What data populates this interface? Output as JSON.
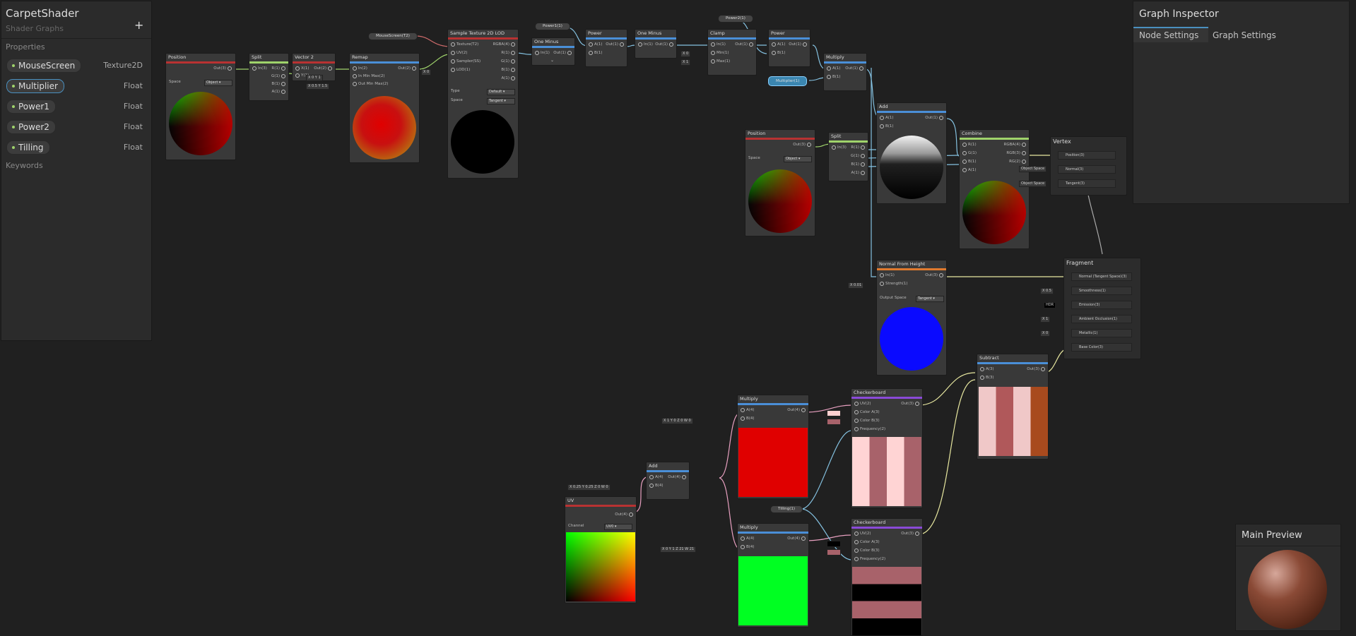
{
  "blackboard": {
    "title": "CarpetShader",
    "subtitle": "Shader Graphs",
    "add_label": "+",
    "properties_header": "Properties",
    "keywords_header": "Keywords",
    "properties": [
      {
        "name": "MouseScreen",
        "type": "Texture2D"
      },
      {
        "name": "Multiplier",
        "type": "Float"
      },
      {
        "name": "Power1",
        "type": "Float"
      },
      {
        "name": "Power2",
        "type": "Float"
      },
      {
        "name": "Tilling",
        "type": "Float"
      }
    ]
  },
  "inspector": {
    "title": "Graph Inspector",
    "tabs": [
      "Node Settings",
      "Graph Settings"
    ]
  },
  "main_preview": {
    "title": "Main Preview"
  },
  "nodes": {
    "position1": {
      "title": "Position",
      "out": "Out(3)",
      "space_label": "Space",
      "space": "Object"
    },
    "split1": {
      "title": "Split",
      "in": "In(3)",
      "outs": [
        "R(1)",
        "G(1)",
        "B(1)",
        "A(1)"
      ]
    },
    "vector2": {
      "title": "Vector 2",
      "in": [
        "X(1)",
        "Y(1)"
      ],
      "out": "Out(2)",
      "x": "0",
      "y": "1",
      "x2": "0.5",
      "y2": "1.5"
    },
    "remap": {
      "title": "Remap",
      "in": [
        "In(2)",
        "In Min Max(2)",
        "Out Min Max(2)"
      ],
      "out": "Out(2)",
      "extra": "0"
    },
    "sampletex": {
      "title": "Sample Texture 2D LOD",
      "ins": [
        "Texture(T2)",
        "UV(2)",
        "Sampler(SS)",
        "LOD(1)"
      ],
      "outs": [
        "RGBA(4)",
        "R(1)",
        "G(1)",
        "B(1)",
        "A(1)"
      ],
      "type_label": "Type",
      "type": "Default",
      "space_label": "Space",
      "space": "Tangent"
    },
    "oneminus1": {
      "title": "One Minus",
      "in": "In(1)",
      "out": "Out(1)"
    },
    "power1": {
      "title": "Power",
      "ins": [
        "A(1)",
        "B(1)"
      ],
      "out": "Out(1)"
    },
    "oneminus2": {
      "title": "One Minus",
      "in": "In(1)",
      "out": "Out(1)"
    },
    "clamp": {
      "title": "Clamp",
      "ins": [
        "In(1)",
        "Min(1)",
        "Max(1)"
      ],
      "out": "Out(1)",
      "min": "0",
      "max": "1"
    },
    "power2": {
      "title": "Power",
      "ins": [
        "A(1)",
        "B(1)"
      ],
      "out": "Out(1)"
    },
    "multiply1": {
      "title": "Multiply",
      "ins": [
        "A(1)",
        "B(1)"
      ],
      "out": "Out(1)"
    },
    "position2": {
      "title": "Position",
      "out": "Out(3)",
      "space_label": "Space",
      "space": "Object"
    },
    "split2": {
      "title": "Split",
      "in": "In(3)",
      "outs": [
        "R(1)",
        "G(1)",
        "B(1)",
        "A(1)"
      ]
    },
    "add1": {
      "title": "Add",
      "ins": [
        "A(1)",
        "B(1)"
      ],
      "out": "Out(1)"
    },
    "combine": {
      "title": "Combine",
      "ins": [
        "R(1)",
        "G(1)",
        "B(1)",
        "A(1)"
      ],
      "outs": [
        "RGBA(4)",
        "RGB(3)",
        "RG(2)"
      ]
    },
    "vertex": {
      "title": "Vertex",
      "slots": [
        "Position(3)",
        "Normal(3)",
        "Tangent(3)"
      ],
      "space_a": "Object Space",
      "space_b": "Object Space"
    },
    "normalfromheight": {
      "title": "Normal From Height",
      "ins": [
        "In(1)",
        "Strength(1)"
      ],
      "out": "Out(3)",
      "strength": "0.01",
      "space_label": "Output Space",
      "space": "Tangent"
    },
    "fragment": {
      "title": "Fragment",
      "slots": [
        "Normal (Tangent Space)(3)",
        "Smoothness(1)",
        "Emission(3)",
        "Ambient Occlusion(1)",
        "Metallic(1)",
        "Base Color(3)"
      ],
      "smooth": "0.5",
      "ao": "1",
      "metal": "0",
      "emission": "HDR"
    },
    "subtract": {
      "title": "Subtract",
      "ins": [
        "A(3)",
        "B(3)"
      ],
      "out": "Out(3)"
    },
    "multiply2": {
      "title": "Multiply",
      "ins": [
        "A(4)",
        "B(4)"
      ],
      "out": "Out(4)",
      "vals": "X 1  Y 0  Z 0  W 0"
    },
    "checker1": {
      "title": "Checkerboard",
      "ins": [
        "UV(2)",
        "Color A(3)",
        "Color B(3)",
        "Frequency(2)"
      ],
      "out": "Out(3)"
    },
    "add2": {
      "title": "Add",
      "ins": [
        "A(4)",
        "B(4)"
      ],
      "out": "Out(4)",
      "vals": "X 0.25  Y 0.25  Z 0  W 0"
    },
    "uv": {
      "title": "UV",
      "out": "Out(4)",
      "channel_label": "Channel",
      "channel": "UV0"
    },
    "multiply3": {
      "title": "Multiply",
      "ins": [
        "A(4)",
        "B(4)"
      ],
      "out": "Out(4)",
      "vals": "X 0  Y 1  Z 21  W 21"
    },
    "checker2": {
      "title": "Checkerboard",
      "ins": [
        "UV(2)",
        "Color A(3)",
        "Color B(3)",
        "Frequency(2)"
      ],
      "out": "Out(3)"
    }
  },
  "prop_nodes": {
    "mousescreen": "MouseScreen(T2)",
    "power1": "Power1(1)",
    "power2": "Power2(1)",
    "multiplier": "Multiplier(1)",
    "tilling": "Tilling(1)"
  }
}
